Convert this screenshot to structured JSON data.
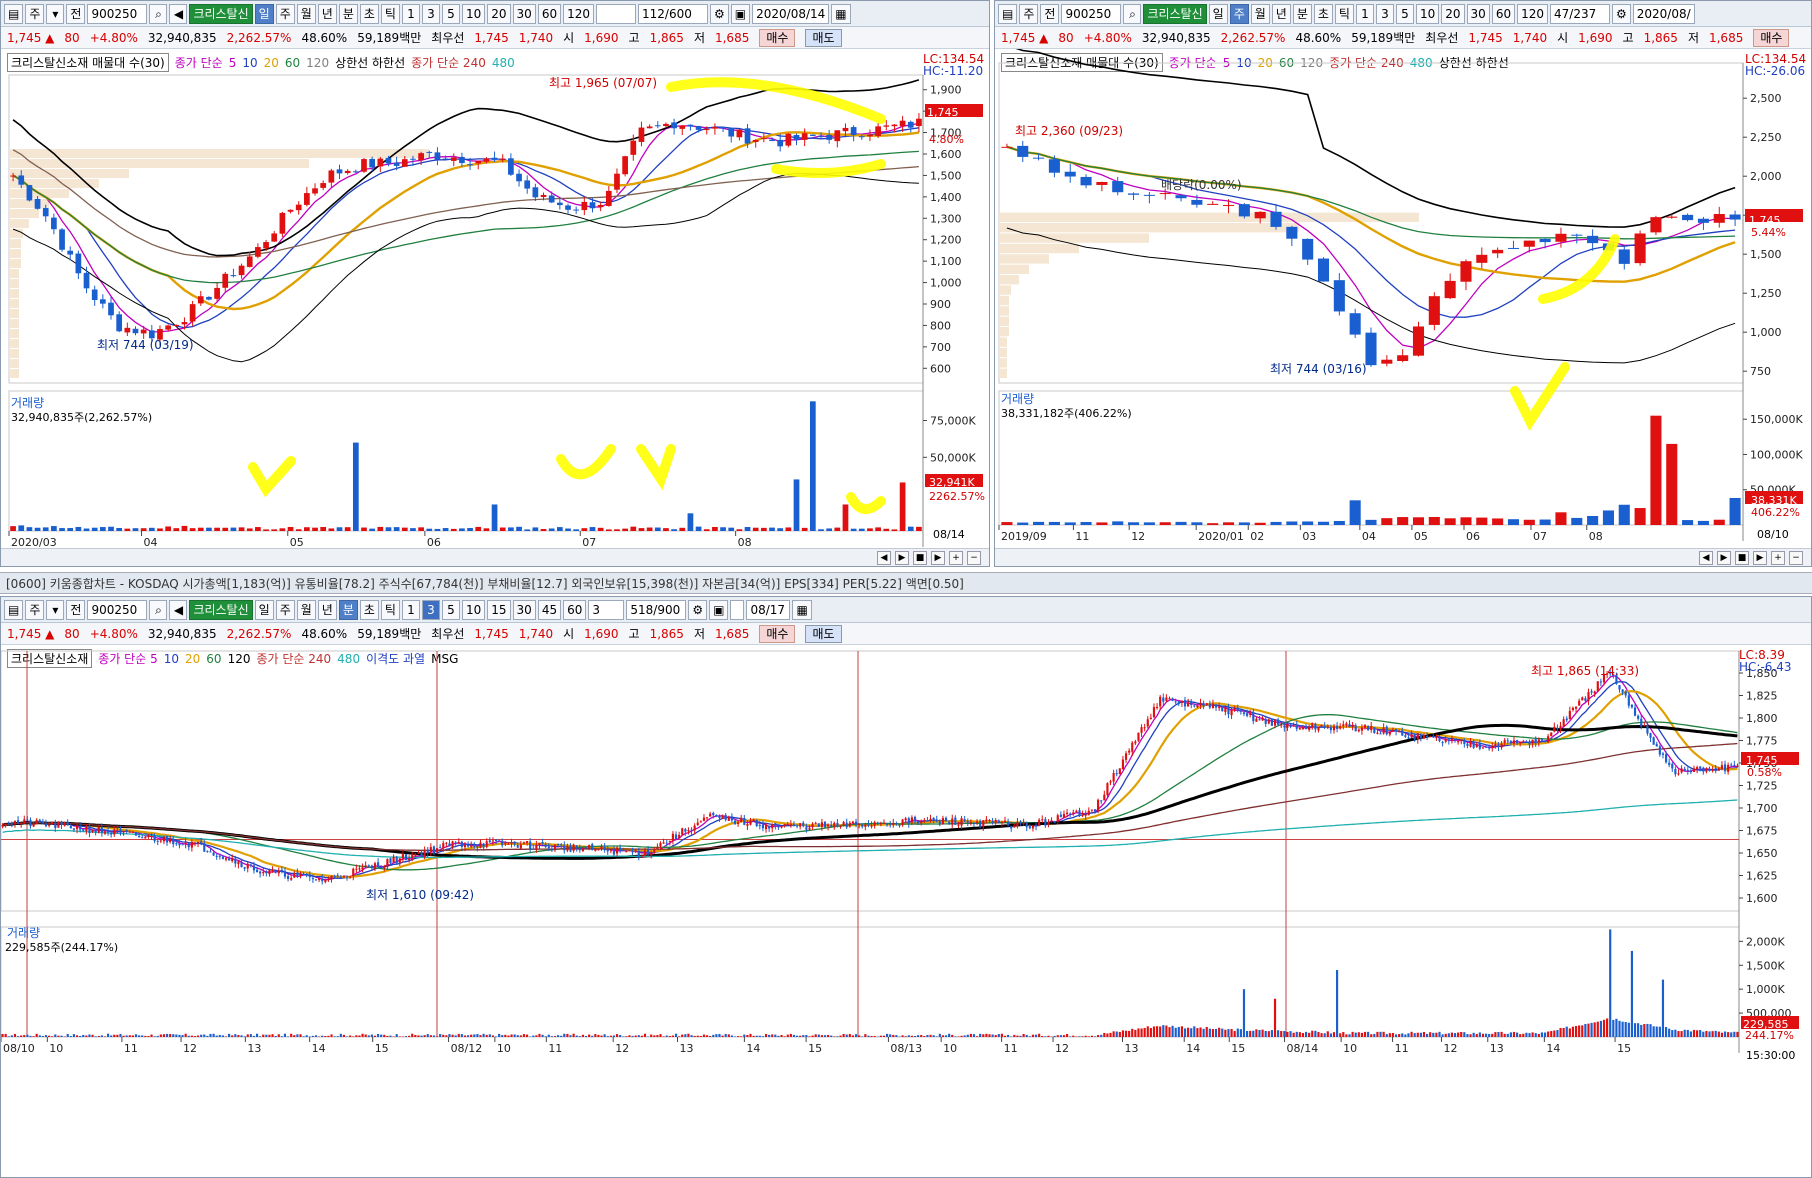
{
  "common": {
    "code": "900250",
    "name": "크리스탈신",
    "jeon": "전",
    "ju": "주",
    "icon_names": [
      "search-icon",
      "speaker-icon",
      "settings-icon",
      "save-icon",
      "calendar-icon",
      "zoom-in-icon",
      "zoom-out-icon"
    ],
    "quote": {
      "price": "1,745 ▲",
      "change": "80",
      "change_pct": "+4.80%",
      "volume": "32,940,835",
      "vol_ratio": "2,262.57%",
      "turnover": "48.60%",
      "amount": "59,189백만",
      "best_ask_label": "최우선",
      "best_ask": "1,745",
      "best_bid": "1,740",
      "open_label": "시",
      "open": "1,690",
      "high_label": "고",
      "high": "1,865",
      "low_label": "저",
      "low": "1,685",
      "buy": "매수",
      "sell": "매도"
    },
    "colors": {
      "up": "#e01010",
      "down": "#1a5fd0",
      "ma5": "#c000c0",
      "ma10": "#2040c0",
      "ma20": "#e0a000",
      "ma60": "#208040",
      "ma120": "#808080",
      "ma240": "#e0a030",
      "ma480": "#20b0b0",
      "bb": "#000000"
    }
  },
  "daily": {
    "periods": [
      "일",
      "주",
      "월",
      "년",
      "분",
      "초",
      "틱"
    ],
    "active_period": "일",
    "nums": [
      "1",
      "3",
      "5",
      "10",
      "20",
      "30",
      "60",
      "120"
    ],
    "count": "112",
    "total": "/600",
    "date": "2020/08/14",
    "legend": {
      "title": "크리스탈신소재 매물대 수(30)",
      "ma_label": "종가 단순",
      "ma": [
        "5",
        "10",
        "20",
        "60",
        "120"
      ],
      "limits": "상한선 하한선",
      "ma2_label": "종가 단순 240",
      "ma2": "480"
    },
    "lc": "LC:134.54",
    "hc": "HC:-11.20",
    "price_tag": "1,745",
    "pct_tag": "4.80%",
    "yticks": [
      "1,900",
      "1,800",
      "1,700",
      "1,600",
      "1,500",
      "1,400",
      "1,300",
      "1,200",
      "1,100",
      "1,000",
      "900",
      "800",
      "700",
      "600"
    ],
    "max_note": "최고 1,965 (07/07)",
    "min_note": "최저 744 (03/19)",
    "vol_title": "거래량",
    "vol_value": "32,940,835주(2,262.57%)",
    "vol_yticks": [
      "75,000K",
      "50,000K"
    ],
    "vol_tag": "32,941K",
    "vol_tag2": "2262.57%",
    "xticks": [
      "2020/03",
      "04",
      "05",
      "06",
      "07",
      "08"
    ],
    "x_end": "08/14"
  },
  "weekly": {
    "active_period": "주",
    "count": "47",
    "total": "/237",
    "date": "2020/08/",
    "legend": {
      "title": "크리스탈신소재 매물대 수(30)",
      "ma_label": "종가 단순",
      "ma": [
        "5",
        "10",
        "20",
        "60",
        "120"
      ],
      "ma2_label": "종가 단순 240",
      "ma2": "480",
      "limits": "상한선 하한선"
    },
    "lc": "LC:134.54",
    "hc": "HC:-26.06",
    "price_tag": "1,745",
    "pct_tag": "5.44%",
    "yticks": [
      "2,500",
      "2,250",
      "2,000",
      "1,750",
      "1,500",
      "1,250",
      "1,000",
      "750"
    ],
    "max_note": "최고 2,360 (09/23)",
    "div_note": "배당락(0.00%)",
    "min_note": "최저 744 (03/16)",
    "vol_title": "거래량",
    "vol_value": "38,331,182주(406.22%)",
    "vol_yticks": [
      "150,000K",
      "100,000K",
      "50,000K"
    ],
    "vol_tag": "38,331K",
    "vol_tag2": "406.22%",
    "xticks": [
      "2019/09",
      "11",
      "12",
      "2020/01",
      "02",
      "03",
      "04",
      "05",
      "06",
      "07",
      "08"
    ],
    "x_end": "08/10"
  },
  "infobar": "[0600] 키움종합차트 - KOSDAQ 시가총액[1,183(억)] 유통비율[78.2] 주식수[67,784(천)] 부채비율[12.7] 외국인보유[15,398(천)] 자본금[34(억)] EPS[334] PER[5.22] 액면[0.50]",
  "minute": {
    "periods": [
      "일",
      "주",
      "월",
      "년",
      "분",
      "초",
      "틱"
    ],
    "active_period": "분",
    "nums": [
      "1",
      "3",
      "5",
      "10",
      "15",
      "30",
      "45",
      "60"
    ],
    "active_num": "3",
    "combo": "3",
    "count": "518",
    "total": "/900",
    "date": "08/17",
    "legend": {
      "title": "크리스탈신소재",
      "ma_label": "종가 단순 5",
      "ma": [
        "10",
        "20",
        "60",
        "120"
      ],
      "ma2_label": "종가 단순 240",
      "ma2": "480",
      "extra": "이격도 과열",
      "msg": "MSG"
    },
    "lc": "LC:8.39",
    "hc": "HC:-6.43",
    "price_tag": "1,745",
    "pct_tag": "0.58%",
    "yticks": [
      "1,850",
      "1,825",
      "1,800",
      "1,775",
      "1,750",
      "1,725",
      "1,700",
      "1,675",
      "1,650",
      "1,625",
      "1,600"
    ],
    "max_note": "최고 1,865 (14:33)",
    "min_note": "최저 1,610 (09:42)",
    "vol_title": "거래량",
    "vol_value": "229,585주(244.17%)",
    "vol_yticks": [
      "2,000K",
      "1,500K",
      "1,000K",
      "500,000"
    ],
    "vol_tag": "229,585",
    "vol_tag2": "244.17%",
    "xticks": [
      "08/10",
      "10",
      "11",
      "12",
      "13",
      "14",
      "15",
      "08/12",
      "10",
      "11",
      "12",
      "13",
      "14",
      "15",
      "08/13",
      "10",
      "11",
      "12",
      "13",
      "14",
      "15",
      "08/14",
      "10",
      "11",
      "12",
      "13",
      "14",
      "15"
    ],
    "x_end": "15:30:00"
  }
}
